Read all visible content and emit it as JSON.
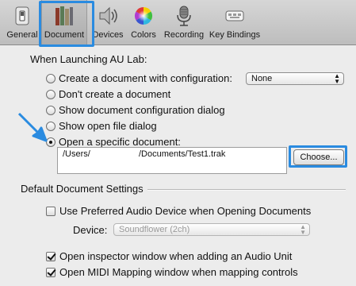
{
  "toolbar": {
    "tabs": [
      {
        "label": "General",
        "icon": "switch-icon"
      },
      {
        "label": "Document",
        "icon": "document-icon",
        "selected": true
      },
      {
        "label": "Devices",
        "icon": "speaker-icon"
      },
      {
        "label": "Colors",
        "icon": "color-wheel-icon"
      },
      {
        "label": "Recording",
        "icon": "microphone-icon"
      },
      {
        "label": "Key Bindings",
        "icon": "keyboard-icon"
      }
    ]
  },
  "launching": {
    "heading": "When Launching AU Lab:",
    "options": [
      {
        "label": "Create a document with configuration:",
        "checked": false
      },
      {
        "label": "Don't create a document",
        "checked": false
      },
      {
        "label": "Show document configuration dialog",
        "checked": false
      },
      {
        "label": "Show open file dialog",
        "checked": false
      },
      {
        "label": "Open a specific document:",
        "checked": true
      }
    ],
    "configuration_popup": "None",
    "document_path": "/Users/                    /Documents/Test1.trak",
    "choose_button": "Choose..."
  },
  "defaults": {
    "heading": "Default Document Settings",
    "use_preferred_device": {
      "label": "Use Preferred Audio Device when Opening Documents",
      "checked": false
    },
    "device_label": "Device:",
    "device_popup": "Soundflower (2ch)",
    "inspector": {
      "label": "Open inspector window when adding an Audio Unit",
      "checked": true
    },
    "midi_mapping": {
      "label": "Open MIDI Mapping window when mapping controls",
      "checked": true
    }
  },
  "colors": {
    "highlight": "#2a8be0",
    "background": "#ececec"
  }
}
